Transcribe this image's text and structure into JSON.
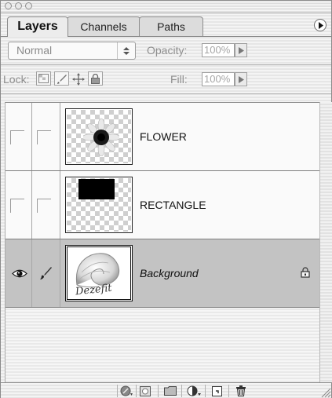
{
  "window": {
    "buttons": [
      "close",
      "minimize",
      "zoom"
    ]
  },
  "tabs": [
    {
      "label": "Layers",
      "active": true
    },
    {
      "label": "Channels",
      "active": false
    },
    {
      "label": "Paths",
      "active": false
    }
  ],
  "blend": {
    "mode": "Normal",
    "opacity_label": "Opacity:",
    "opacity_value": "100%"
  },
  "lock": {
    "label": "Lock:",
    "fill_label": "Fill:",
    "fill_value": "100%"
  },
  "layers": [
    {
      "name": "FLOWER",
      "visible": false,
      "selected": false,
      "locked": false,
      "thumb_icon": "flower-thumbnail"
    },
    {
      "name": "RECTANGLE",
      "visible": false,
      "selected": false,
      "locked": false,
      "thumb_icon": "black-rectangle-thumbnail"
    },
    {
      "name": "Background",
      "visible": true,
      "selected": true,
      "locked": true,
      "thumb_icon": "seashell-thumbnail",
      "thumb_text": "Dezefit"
    }
  ],
  "bottom_icons": [
    "layer-style-icon",
    "layer-mask-icon",
    "new-set-icon",
    "adjustment-layer-icon",
    "new-layer-icon",
    "trash-icon"
  ],
  "colors": {
    "selected_row": "#c3c3c3",
    "panel_bg": "#ececec"
  }
}
